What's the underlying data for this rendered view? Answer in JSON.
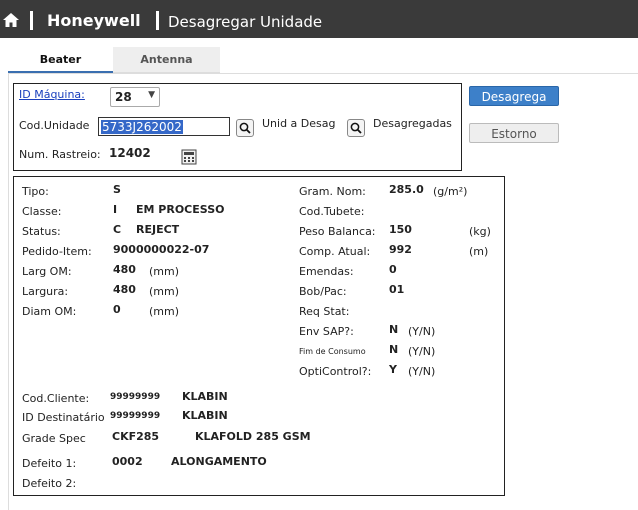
{
  "header": {
    "brand": "Honeywell",
    "title": "Desagregar Unidade"
  },
  "tabs": [
    {
      "label": "Beater",
      "active": true
    },
    {
      "label": "Antenna",
      "active": false
    }
  ],
  "form": {
    "id_maquina_label": "ID Máquina:",
    "id_maquina_value": "28",
    "cod_unidade_label": "Cod.Unidade",
    "cod_unidade_value": "5733J262002",
    "unid_a_desag_label": "Unid a Desag",
    "desagregadas_label": "Desagregadas",
    "num_rastreio_label": "Num. Rastreio:",
    "num_rastreio_value": "12402"
  },
  "buttons": {
    "desagrega": "Desagrega",
    "estorno": "Estorno"
  },
  "details": {
    "tipo_label": "Tipo:",
    "tipo_value": "S",
    "classe_label": "Classe:",
    "classe_code": "I",
    "classe_text": "EM PROCESSO",
    "status_label": "Status:",
    "status_code": "C",
    "status_text": "REJECT",
    "pedido_label": "Pedido-Item:",
    "pedido_value": "9000000022-07",
    "larg_om_label": "Larg OM:",
    "larg_om_value": "480",
    "larg_om_unit": "(mm)",
    "largura_label": "Largura:",
    "largura_value": "480",
    "largura_unit": "(mm)",
    "diam_om_label": "Diam OM:",
    "diam_om_value": "0",
    "diam_om_unit": "(mm)",
    "gram_label": "Gram. Nom:",
    "gram_value": "285.0",
    "gram_unit": "(g/m²)",
    "cod_tubete_label": "Cod.Tubete:",
    "peso_label": "Peso Balanca:",
    "peso_value": "150",
    "peso_unit": "(kg)",
    "comp_label": "Comp. Atual:",
    "comp_value": "992",
    "comp_unit": "(m)",
    "emendas_label": "Emendas:",
    "emendas_value": "0",
    "bob_label": "Bob/Pac:",
    "bob_value": "01",
    "req_label": "Req Stat:",
    "env_label": "Env SAP?:",
    "env_value": "N",
    "env_unit": "(Y/N)",
    "fim_label": "Fim de Consumo",
    "fim_value": "N",
    "fim_unit": "(Y/N)",
    "opti_label": "OptiControl?:",
    "opti_value": "Y",
    "opti_unit": "(Y/N)",
    "cliente_label": "Cod.Cliente:",
    "cliente_code": "99999999",
    "cliente_name": "KLABIN",
    "dest_label": "ID Destinatário",
    "dest_code": "99999999",
    "dest_name": "KLABIN",
    "grade_label": "Grade Spec",
    "grade_code": "CKF285",
    "grade_name": "KLAFOLD 285 GSM",
    "defeito1_label": "Defeito 1:",
    "defeito1_code": "0002",
    "defeito1_text": "ALONGAMENTO",
    "defeito2_label": "Defeito 2:"
  }
}
